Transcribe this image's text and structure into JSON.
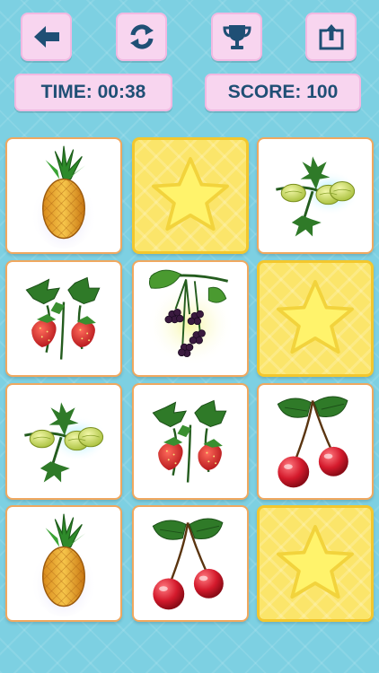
{
  "toolbar": {
    "back_icon": "back-arrow-icon",
    "restart_icon": "restart-icon",
    "leaderboard_icon": "trophy-icon",
    "share_icon": "share-icon"
  },
  "status": {
    "time_label": "TIME: 00:38",
    "score_label": "SCORE: 100"
  },
  "board": {
    "rows": 4,
    "columns": 3,
    "cards": [
      {
        "state": "face-up",
        "fruit": "pineapple"
      },
      {
        "state": "face-down",
        "fruit": ""
      },
      {
        "state": "face-up",
        "fruit": "gooseberry"
      },
      {
        "state": "face-up",
        "fruit": "strawberry"
      },
      {
        "state": "face-up",
        "fruit": "blackberry"
      },
      {
        "state": "face-down",
        "fruit": ""
      },
      {
        "state": "face-up",
        "fruit": "gooseberry"
      },
      {
        "state": "face-up",
        "fruit": "strawberry"
      },
      {
        "state": "face-up",
        "fruit": "cherry"
      },
      {
        "state": "face-up",
        "fruit": "pineapple"
      },
      {
        "state": "face-up",
        "fruit": "cherry"
      },
      {
        "state": "face-down",
        "fruit": ""
      }
    ]
  },
  "colors": {
    "background": "#7dd0e2",
    "button_fill": "#f8d5ef",
    "text": "#1f4f75",
    "card_border": "#f0a85f",
    "card_back": "#fbe56a"
  }
}
